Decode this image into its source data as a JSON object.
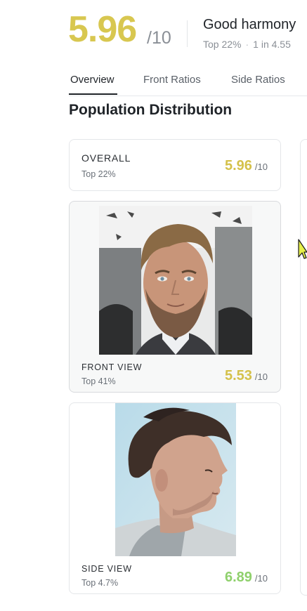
{
  "header": {
    "score": "5.96",
    "score_denominator": "/10",
    "harmony_title": "Good harmony",
    "harmony_top": "Top 22%",
    "harmony_rarity": "1 in 4.55"
  },
  "tabs": [
    {
      "label": "Overview",
      "active": true
    },
    {
      "label": "Front Ratios",
      "active": false
    },
    {
      "label": "Side Ratios",
      "active": false
    }
  ],
  "section_title": "Population Distribution",
  "cards": {
    "overall": {
      "label": "OVERALL",
      "sub": "Top 22%",
      "score": "5.96",
      "denominator": "/10",
      "color": "#d4c14a"
    },
    "front": {
      "label": "FRONT VIEW",
      "sub": "Top 41%",
      "score": "5.53",
      "denominator": "/10",
      "color": "#d4c14a"
    },
    "side": {
      "label": "SIDE VIEW",
      "sub": "Top 4.7%",
      "score": "6.89",
      "denominator": "/10",
      "color": "#8fd06c"
    }
  },
  "colors": {
    "accent_yellow": "#d8c750",
    "accent_green": "#8fd06c",
    "cursor": "#e6f04a"
  }
}
